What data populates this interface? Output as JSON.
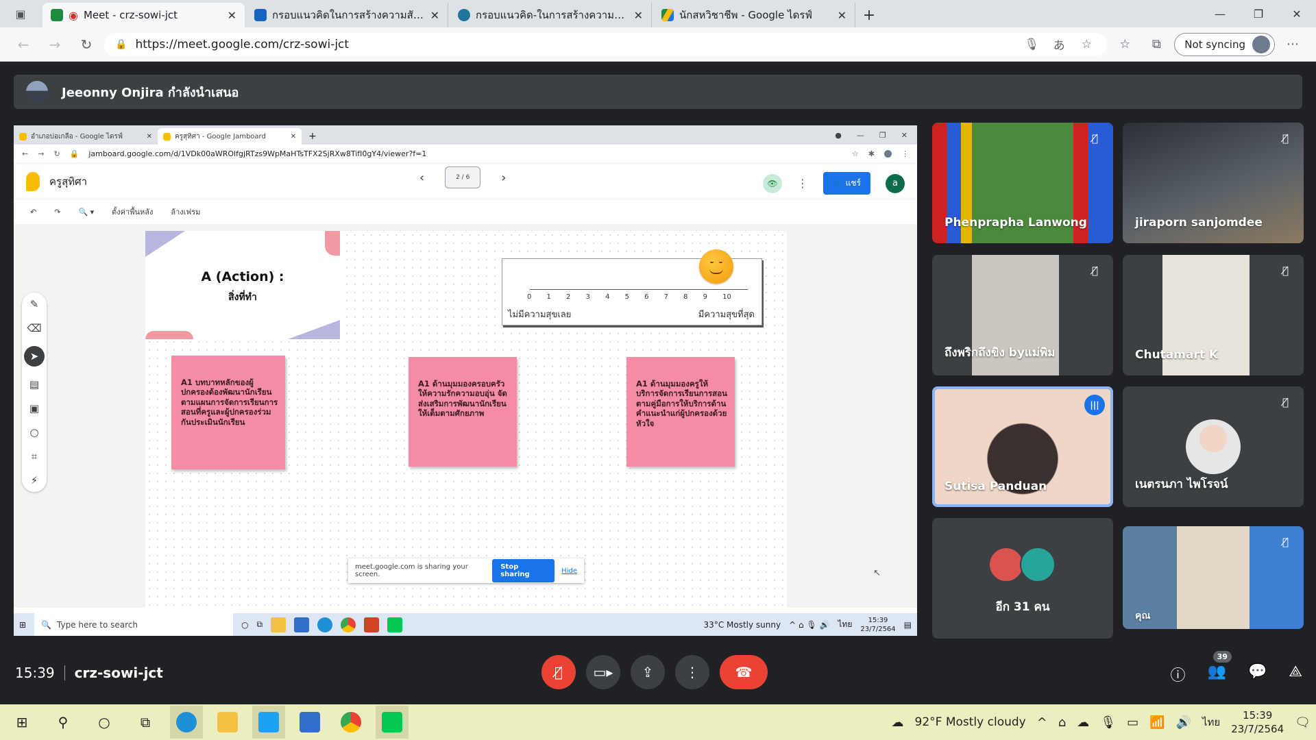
{
  "browser": {
    "tabs": [
      {
        "label": "Meet - crz-sowi-jct",
        "active": true,
        "favicon_color": "#1e8e3e"
      },
      {
        "label": "กรอบแนวคิดในการสร้างความสัมพันธ์",
        "active": false,
        "favicon_color": "#1565c0"
      },
      {
        "label": "กรอบแนวคิด-ในการสร้างความสัมพันธ์",
        "active": false,
        "favicon_color": "#21759b"
      },
      {
        "label": "นักสหวิชาชีพ - Google ไดรฟ์",
        "active": false,
        "favicon_color": "#fbbc04"
      }
    ],
    "url": "https://meet.google.com/crz-sowi-jct",
    "sync_label": "Not syncing"
  },
  "meet": {
    "presenter_text": "Jeeonny Onjira กำลังนำเสนอ",
    "time": "15:39",
    "meeting_code": "crz-sowi-jct",
    "participant_count": "39",
    "accent": "#1a73e8",
    "danger": "#ea4335"
  },
  "shared_screen": {
    "tabs": [
      {
        "label": "อำเภอบ่อเกลือ - Google ไดรฟ์"
      },
      {
        "label": "ครูสุทิศา - Google Jamboard"
      }
    ],
    "url": "jamboard.google.com/d/1VDk00aWROlfgjRTzs9WpMaHTsTFX2SjRXw8TifI0gY4/viewer?f=1",
    "jam_title": "ครูสุทิศา",
    "frame_indicator": "2 / 6",
    "share_label": "แชร์",
    "user_initial": "a",
    "tool_set_background": "ตั้งค่าพื้นหลัง",
    "tool_clear_frame": "ล้างเฟรม",
    "board": {
      "title_main": "A (Action) :",
      "title_sub": "สิ่งที่ทำ",
      "scale_numbers": [
        "0",
        "1",
        "2",
        "3",
        "4",
        "5",
        "6",
        "7",
        "8",
        "9",
        "10"
      ],
      "scale_low": "ไม่มีความสุขเลย",
      "scale_high": "มีความสุขที่สุด",
      "stickies": [
        "A1 บทบาทหลักของผู้ปกครองต้องพัฒนานักเรียนตามแผนการจัดการเรียนการสอนที่ครูและผู้ปกครองร่วมกันประเมินนักเรียน",
        "A1 ด้านมุมมองครอบครัวให้ความรักความอบอุ่น จัดส่งเสริมการพัฒนานักเรียนให้เต็มตามศักยภาพ",
        "A1 ด้านมุมมองครูให้บริการจัดการเรียนการสอนตามคู่มือการให้บริการด้านคำแนะนำแก่ผู้ปกครองด้วยหัวใจ"
      ],
      "sticky_color": "#f48ca5"
    },
    "share_notice": "meet.google.com is sharing your screen.",
    "stop_sharing": "Stop sharing",
    "hide": "Hide",
    "taskbar": {
      "search_placeholder": "Type here to search",
      "weather": "33°C  Mostly sunny",
      "lang": "ไทย",
      "time": "15:39",
      "date": "23/7/2564"
    }
  },
  "participants": [
    {
      "name": "Phenprapha Lanwong",
      "muted": true
    },
    {
      "name": "jiraporn sanjomdee",
      "muted": true
    },
    {
      "name": "ถึงพริกถึงขิง byแม่พิม",
      "muted": true
    },
    {
      "name": "Chutamart K",
      "muted": true
    },
    {
      "name": "Sutisa Panduan",
      "speaking": true
    },
    {
      "name": "เนตรนภา ไพโรจน์",
      "muted": true
    },
    {
      "name": "อีก 31 คน"
    },
    {
      "name": "คุณ",
      "muted": true
    }
  ],
  "windows_taskbar": {
    "weather": "92°F  Mostly cloudy",
    "lang": "ไทย",
    "time": "15:39",
    "date": "23/7/2564",
    "background": "#eceec0"
  }
}
